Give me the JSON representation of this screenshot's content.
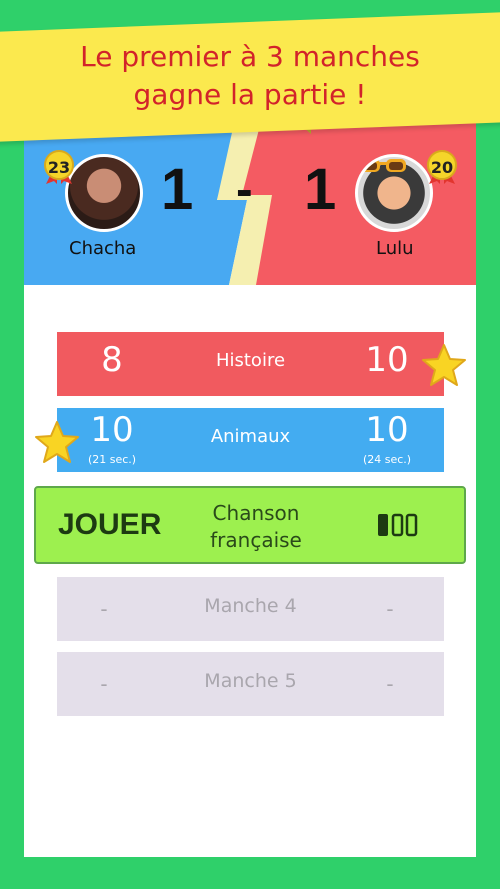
{
  "banner": {
    "line1": "Le premier à 3 manches",
    "line2": "gagne la partie !"
  },
  "colors": {
    "left_team": "#48a9f2",
    "right_team": "#f45b62",
    "lightning": "#f5efb0",
    "banner_bg": "#fbe94e",
    "banner_text": "#d2232a",
    "background": "#2fd06a",
    "play_button": "#9df04f"
  },
  "player_left": {
    "name": "Chacha",
    "level": "23",
    "score": "1"
  },
  "player_right": {
    "name": "Lulu",
    "level": "20",
    "score": "1"
  },
  "score_separator": "-",
  "rounds": [
    {
      "category": "Histoire",
      "left_score": "8",
      "right_score": "10",
      "left_time": "",
      "right_time": "",
      "winner": "right"
    },
    {
      "category": "Animaux",
      "left_score": "10",
      "right_score": "10",
      "left_time": "(21 sec.)",
      "right_time": "(24 sec.)",
      "winner": "left"
    }
  ],
  "current_round": {
    "action_label": "JOUER",
    "category_line1": "Chanson",
    "category_line2": "française",
    "icon": "progress-bars-icon"
  },
  "upcoming_rounds": [
    {
      "label": "Manche 4",
      "left": "-",
      "right": "-"
    },
    {
      "label": "Manche 5",
      "left": "-",
      "right": "-"
    }
  ]
}
